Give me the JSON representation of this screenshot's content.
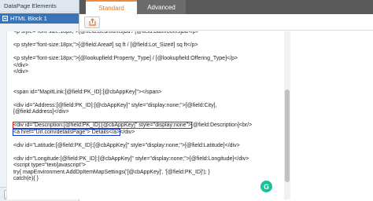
{
  "sidebar": {
    "header": "DataPage Elements",
    "items": [
      {
        "label": "HTML Block 1"
      }
    ],
    "footer_buttons": [
      {
        "icon": "arrow-up-icon",
        "glyph": "⬆"
      },
      {
        "icon": "arrow-down-icon",
        "glyph": "⬇"
      },
      {
        "icon": "delete-icon",
        "glyph": "✕"
      },
      {
        "icon": "add-element-icon",
        "glyph": "⊕▾"
      }
    ]
  },
  "tabs": [
    {
      "label": "Standard",
      "active": true
    },
    {
      "label": "Advanced",
      "active": false
    }
  ],
  "editor": {
    "lines": [
      "<p style=\"font-size:18px;\">[@field:Area#] sq ft / [@field:Lot_Size#] sq ft</p>",
      "",
      "<p style=\"font-size:18px;\">[@lookupfield:Property_Type] / [@lookupfield:Offering_Type]</p>",
      "</div>",
      "</div>",
      "",
      "",
      "<span id=\"MapItLink:[@field:PK_ID]:[@cbAppKey]\"></span>",
      "",
      "<div id=\"Address:[@field:PK_ID]:[@cbAppKey]\" style=\"display:none;\">[@field:City],",
      "[@field:Address]</div>",
      ""
    ],
    "highlight_red": "<div id=\"Description:[@field:PK_ID]:[@cbAppKey]\" style=\"display:none\">",
    "after_red": "[@field:Description]<br/>",
    "highlight_blue": "<a href=\"Url.com/detailsPage\"> Details</a>",
    "after_blue": "</div>",
    "lines_after": [
      "",
      "<div id=\"Latitude:[@field:PK_ID]:[@cbAppKey]\" style=\"display:none;\">[@field:Latitude]</div>",
      "",
      "<div id=\"Longitude:[@field:PK_ID]:[@cbAppKey]\" style=\"display:none;\">[@field:Longitude]</div>",
      "<script type=\"text/javascript\">",
      "   try{ mapEnvironment.AddDpItemMapSettings('[@cbAppKey]', '[@field:PK_ID]'); }",
      "   catch(e){ }"
    ]
  },
  "grammarly": {
    "glyph": "G"
  },
  "colors": {
    "accent": "#f08a3c",
    "selection": "#3a74b8",
    "highlight_red": "#e01010",
    "highlight_blue": "#1030c8"
  }
}
